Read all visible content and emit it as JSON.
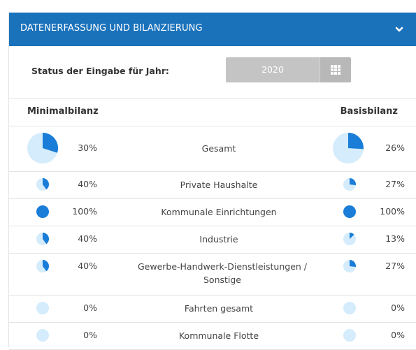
{
  "header": {
    "title": "DATENERFASSUNG UND BILANZIERUNG"
  },
  "status": {
    "label": "Status der Eingabe für Jahr:",
    "year": "2020"
  },
  "columns": {
    "left": "Minimalbilanz",
    "right": "Basisbilanz"
  },
  "colors": {
    "header_bg": "#1a72bb",
    "pie_fill": "#1a7dd8",
    "pie_bg": "#d4ecfb",
    "button_bg": "#c4c4c4"
  },
  "rows": [
    {
      "name": "Gesamt",
      "min_pct": "30%",
      "basis_pct": "26%",
      "min_fraction": 0.3,
      "basis_fraction": 0.26
    },
    {
      "name": "Private Haushalte",
      "min_pct": "40%",
      "basis_pct": "27%",
      "min_fraction": 0.4,
      "basis_fraction": 0.27
    },
    {
      "name": "Kommunale Einrichtungen",
      "min_pct": "100%",
      "basis_pct": "100%",
      "min_fraction": 1.0,
      "basis_fraction": 1.0
    },
    {
      "name": "Industrie",
      "min_pct": "40%",
      "basis_pct": "13%",
      "min_fraction": 0.4,
      "basis_fraction": 0.13
    },
    {
      "name": "Gewerbe-Handwerk-Dienstleistungen / Sonstige",
      "min_pct": "40%",
      "basis_pct": "27%",
      "min_fraction": 0.4,
      "basis_fraction": 0.27
    },
    {
      "name": "Fahrten gesamt",
      "min_pct": "0%",
      "basis_pct": "0%",
      "min_fraction": 0,
      "basis_fraction": 0
    },
    {
      "name": "Kommunale Flotte",
      "min_pct": "0%",
      "basis_pct": "0%",
      "min_fraction": 0,
      "basis_fraction": 0
    }
  ]
}
